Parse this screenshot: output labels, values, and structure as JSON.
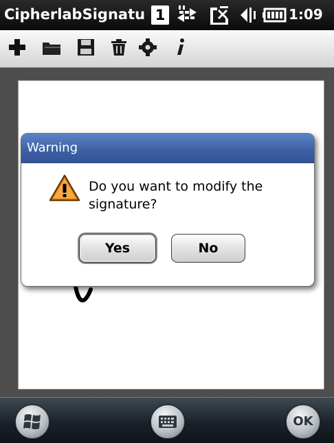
{
  "status_bar": {
    "app_title": "CipherlabSignatu",
    "badge": "1",
    "time": "1:09",
    "icons": [
      "data-sync-icon",
      "no-signal-icon",
      "volume-icon",
      "battery-icon"
    ]
  },
  "toolbar": {
    "tools": [
      "add-icon",
      "folder-open-icon",
      "save-icon",
      "trash-icon",
      "gear-icon",
      "info-icon"
    ]
  },
  "dialog": {
    "title": "Warning",
    "icon": "warning-triangle-icon",
    "message": "Do you want to modify the signature?",
    "yes_label": "Yes",
    "no_label": "No"
  },
  "softkeys": {
    "left_icon": "windows-start-icon",
    "center_icon": "keyboard-icon",
    "right_label": "OK"
  },
  "colors": {
    "titlebar": "#111111",
    "dialog_header": "#3c5fa4",
    "warning_fill": "#f0901e",
    "softbar": "#1a2229"
  }
}
